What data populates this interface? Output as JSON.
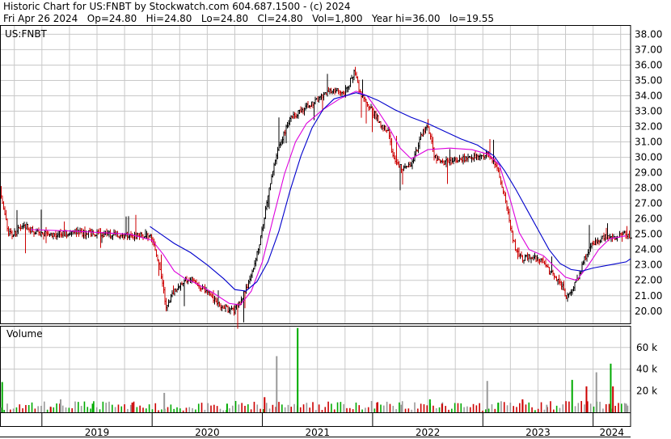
{
  "header": {
    "line1": "Historic Chart for US:FNBT by Stockwatch.com 604.687.1500 - (c) 2024",
    "line2": "Fri Apr 26 2024   Op=24.80   Hi=24.80   Lo=24.80   Cl=24.80   Vol=1,800   Year hi=36.00   lo=19.55"
  },
  "chart_data": [
    {
      "type": "line",
      "title": "US:FNBT",
      "description_style": "daily OHLC bars with moving averages",
      "x_axis": {
        "labels": [
          "2019",
          "2020",
          "2021",
          "2022",
          "2023",
          "2024"
        ]
      },
      "y_axis": {
        "ticks": [
          20,
          21,
          22,
          23,
          24,
          25,
          26,
          27,
          28,
          29,
          30,
          31,
          32,
          33,
          34,
          35,
          36,
          37,
          38
        ],
        "tick_labels": [
          "20.00",
          "21.00",
          "22.00",
          "23.00",
          "24.00",
          "25.00",
          "26.00",
          "27.00",
          "28.00",
          "29.00",
          "30.00",
          "31.00",
          "32.00",
          "33.00",
          "34.00",
          "35.00",
          "36.00",
          "37.00",
          "38.00"
        ],
        "ylim": [
          19.2,
          38.6
        ]
      },
      "t_range": [
        2018.62,
        2024.34
      ],
      "price_path": [
        [
          2018.62,
          27.9
        ],
        [
          2018.66,
          26.3
        ],
        [
          2018.7,
          25.1
        ],
        [
          2018.74,
          24.9
        ],
        [
          2018.78,
          25.3
        ],
        [
          2018.84,
          25.6
        ],
        [
          2018.9,
          25.3
        ],
        [
          2018.96,
          25.1
        ],
        [
          2019.1,
          25.0
        ],
        [
          2019.3,
          25.1
        ],
        [
          2019.55,
          25.0
        ],
        [
          2019.8,
          24.9
        ],
        [
          2019.98,
          24.9
        ],
        [
          2020.04,
          23.7
        ],
        [
          2020.1,
          21.5
        ],
        [
          2020.13,
          20.2
        ],
        [
          2020.18,
          21.1
        ],
        [
          2020.24,
          21.6
        ],
        [
          2020.3,
          22.0
        ],
        [
          2020.36,
          22.1
        ],
        [
          2020.42,
          21.7
        ],
        [
          2020.5,
          21.3
        ],
        [
          2020.58,
          20.6
        ],
        [
          2020.66,
          20.2
        ],
        [
          2020.74,
          20.0
        ],
        [
          2020.8,
          20.6
        ],
        [
          2020.86,
          21.6
        ],
        [
          2020.92,
          22.9
        ],
        [
          2020.98,
          24.6
        ],
        [
          2021.03,
          26.6
        ],
        [
          2021.08,
          28.6
        ],
        [
          2021.14,
          30.6
        ],
        [
          2021.2,
          31.6
        ],
        [
          2021.26,
          32.6
        ],
        [
          2021.32,
          32.9
        ],
        [
          2021.4,
          33.3
        ],
        [
          2021.5,
          33.7
        ],
        [
          2021.58,
          34.2
        ],
        [
          2021.66,
          34.4
        ],
        [
          2021.74,
          34.1
        ],
        [
          2021.8,
          35.0
        ],
        [
          2021.84,
          35.6
        ],
        [
          2021.88,
          34.3
        ],
        [
          2021.94,
          33.6
        ],
        [
          2022.02,
          32.8
        ],
        [
          2022.08,
          32.1
        ],
        [
          2022.14,
          31.6
        ],
        [
          2022.2,
          29.6
        ],
        [
          2022.28,
          29.3
        ],
        [
          2022.36,
          29.6
        ],
        [
          2022.44,
          31.4
        ],
        [
          2022.5,
          32.1
        ],
        [
          2022.56,
          30.1
        ],
        [
          2022.62,
          29.6
        ],
        [
          2022.72,
          29.8
        ],
        [
          2022.84,
          29.9
        ],
        [
          2022.96,
          30.1
        ],
        [
          2023.04,
          30.2
        ],
        [
          2023.1,
          29.7
        ],
        [
          2023.16,
          28.6
        ],
        [
          2023.22,
          26.6
        ],
        [
          2023.26,
          25.1
        ],
        [
          2023.3,
          23.9
        ],
        [
          2023.36,
          23.4
        ],
        [
          2023.42,
          23.6
        ],
        [
          2023.48,
          23.4
        ],
        [
          2023.54,
          23.2
        ],
        [
          2023.6,
          22.6
        ],
        [
          2023.66,
          22.2
        ],
        [
          2023.72,
          21.6
        ],
        [
          2023.76,
          20.9
        ],
        [
          2023.8,
          21.3
        ],
        [
          2023.86,
          22.1
        ],
        [
          2023.92,
          23.4
        ],
        [
          2023.98,
          24.2
        ],
        [
          2024.04,
          24.6
        ],
        [
          2024.12,
          24.9
        ],
        [
          2024.2,
          24.8
        ],
        [
          2024.28,
          25.0
        ],
        [
          2024.34,
          24.8
        ]
      ],
      "ma_fast": [
        [
          2018.9,
          25.3
        ],
        [
          2019.3,
          25.2
        ],
        [
          2019.8,
          25.0
        ],
        [
          2020.0,
          24.6
        ],
        [
          2020.1,
          23.7
        ],
        [
          2020.2,
          22.6
        ],
        [
          2020.3,
          22.1
        ],
        [
          2020.4,
          21.8
        ],
        [
          2020.55,
          21.2
        ],
        [
          2020.7,
          20.5
        ],
        [
          2020.8,
          20.4
        ],
        [
          2020.9,
          21.3
        ],
        [
          2021.0,
          23.2
        ],
        [
          2021.1,
          26.1
        ],
        [
          2021.2,
          28.9
        ],
        [
          2021.3,
          31.0
        ],
        [
          2021.4,
          32.2
        ],
        [
          2021.55,
          33.1
        ],
        [
          2021.7,
          33.8
        ],
        [
          2021.85,
          34.3
        ],
        [
          2021.95,
          34.0
        ],
        [
          2022.05,
          33.0
        ],
        [
          2022.15,
          31.9
        ],
        [
          2022.25,
          30.6
        ],
        [
          2022.35,
          29.9
        ],
        [
          2022.5,
          30.5
        ],
        [
          2022.7,
          30.6
        ],
        [
          2022.9,
          30.5
        ],
        [
          2023.05,
          30.2
        ],
        [
          2023.15,
          29.5
        ],
        [
          2023.25,
          27.2
        ],
        [
          2023.33,
          25.1
        ],
        [
          2023.42,
          24.0
        ],
        [
          2023.55,
          23.6
        ],
        [
          2023.65,
          22.9
        ],
        [
          2023.75,
          22.2
        ],
        [
          2023.85,
          22.0
        ],
        [
          2023.95,
          22.9
        ],
        [
          2024.05,
          24.0
        ],
        [
          2024.15,
          24.7
        ],
        [
          2024.3,
          24.9
        ]
      ],
      "ma_slow": [
        [
          2019.98,
          25.5
        ],
        [
          2020.1,
          24.9
        ],
        [
          2020.2,
          24.4
        ],
        [
          2020.35,
          23.8
        ],
        [
          2020.5,
          23.0
        ],
        [
          2020.65,
          22.1
        ],
        [
          2020.75,
          21.4
        ],
        [
          2020.85,
          21.3
        ],
        [
          2020.95,
          21.9
        ],
        [
          2021.05,
          23.2
        ],
        [
          2021.15,
          25.2
        ],
        [
          2021.25,
          27.8
        ],
        [
          2021.35,
          30.1
        ],
        [
          2021.45,
          31.9
        ],
        [
          2021.55,
          33.1
        ],
        [
          2021.65,
          33.8
        ],
        [
          2021.75,
          34.0
        ],
        [
          2021.85,
          34.2
        ],
        [
          2021.95,
          34.0
        ],
        [
          2022.05,
          33.7
        ],
        [
          2022.2,
          33.1
        ],
        [
          2022.35,
          32.6
        ],
        [
          2022.5,
          32.2
        ],
        [
          2022.65,
          31.7
        ],
        [
          2022.8,
          31.2
        ],
        [
          2022.95,
          30.8
        ],
        [
          2023.1,
          30.1
        ],
        [
          2023.2,
          29.1
        ],
        [
          2023.3,
          27.9
        ],
        [
          2023.4,
          26.6
        ],
        [
          2023.5,
          25.3
        ],
        [
          2023.6,
          24.0
        ],
        [
          2023.7,
          23.1
        ],
        [
          2023.8,
          22.7
        ],
        [
          2023.9,
          22.6
        ],
        [
          2024.0,
          22.8
        ],
        [
          2024.15,
          23.0
        ],
        [
          2024.3,
          23.2
        ],
        [
          2024.34,
          23.4
        ]
      ],
      "colors": {
        "up": "#000000",
        "down": "#cc0000",
        "ma_fast": "#dd00dd",
        "ma_slow": "#0000cc",
        "grid": "#c8c8c8"
      }
    },
    {
      "type": "bar",
      "title": "Volume",
      "y_axis": {
        "ticks": [
          20000,
          40000,
          60000
        ],
        "tick_labels": [
          "20 k",
          "40 k",
          "60 k"
        ],
        "ylim": [
          0,
          80000
        ]
      },
      "spikes": [
        [
          2018.64,
          28000
        ],
        [
          2019.08,
          5000
        ],
        [
          2019.17,
          12000
        ],
        [
          2019.46,
          8000
        ],
        [
          2019.82,
          9000
        ],
        [
          2020.11,
          18000
        ],
        [
          2020.68,
          8000
        ],
        [
          2021.02,
          14000
        ],
        [
          2021.13,
          52000
        ],
        [
          2021.32,
          78000
        ],
        [
          2022.04,
          9000
        ],
        [
          2022.26,
          7000
        ],
        [
          2022.52,
          12000
        ],
        [
          2022.63,
          8000
        ],
        [
          2023.04,
          29000
        ],
        [
          2023.14,
          9000
        ],
        [
          2023.36,
          12000
        ],
        [
          2023.58,
          7000
        ],
        [
          2023.81,
          30000
        ],
        [
          2023.94,
          24000
        ],
        [
          2024.03,
          37000
        ],
        [
          2024.16,
          45000
        ],
        [
          2024.18,
          24000
        ],
        [
          2024.3,
          8000
        ]
      ],
      "colors": {
        "up": "#00aa00",
        "down": "#cc0000",
        "flat": "#999999"
      }
    }
  ]
}
